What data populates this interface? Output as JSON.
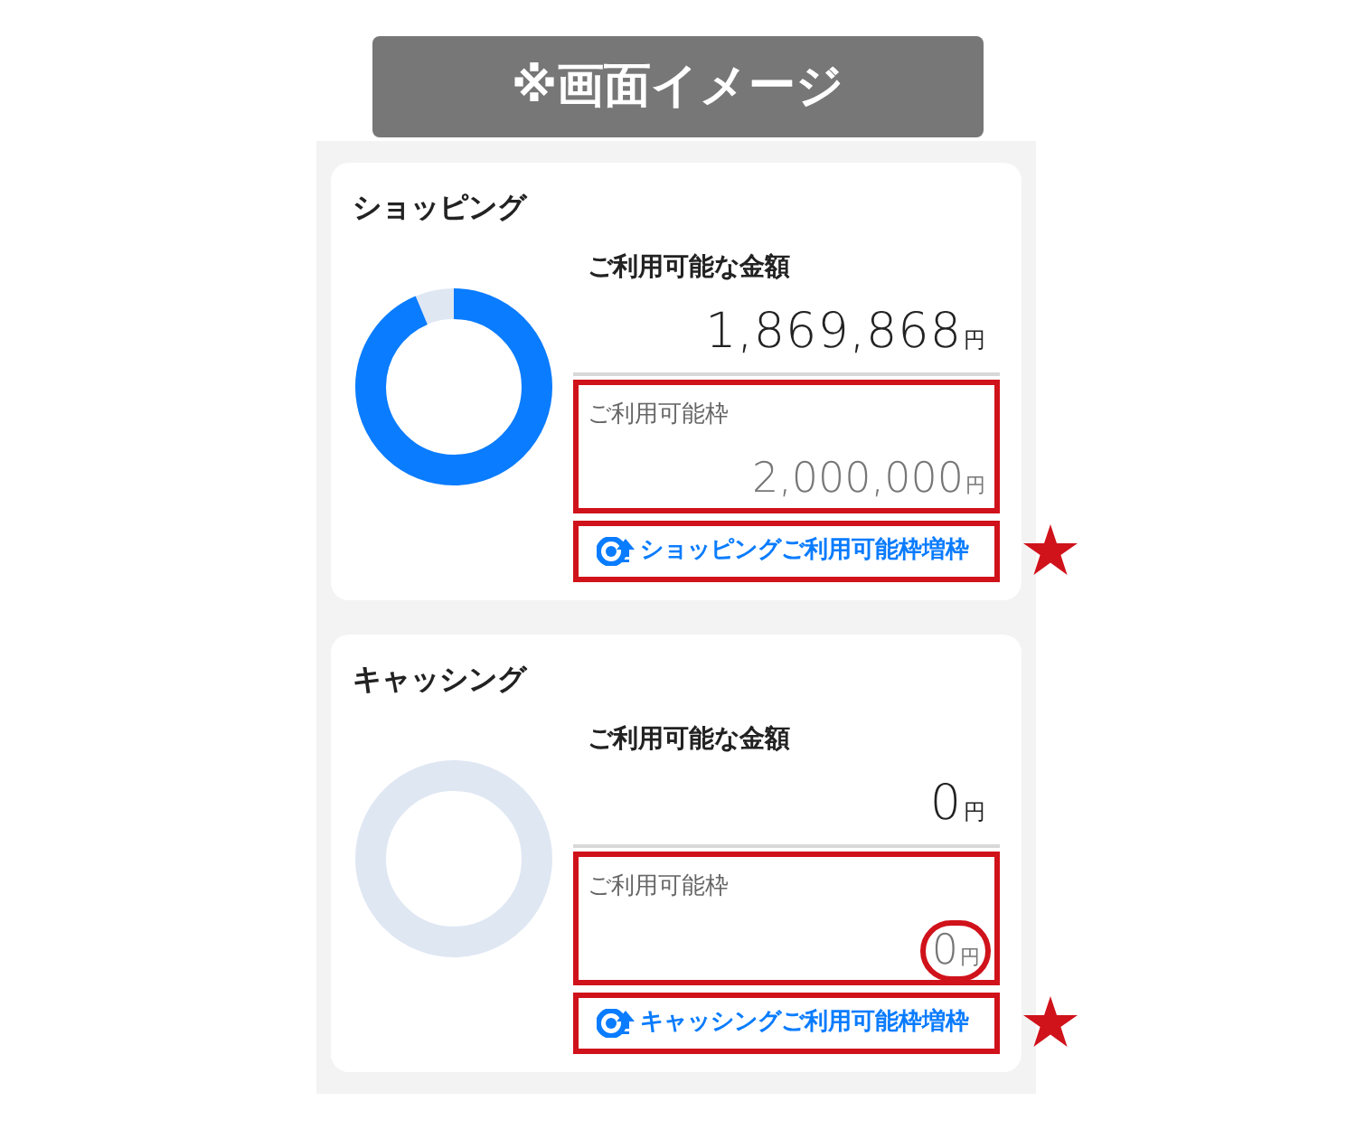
{
  "banner": {
    "title": "※画面イメージ"
  },
  "cards": [
    {
      "title": "ショッピング",
      "available_label": "ご利用可能な金額",
      "available_amount": "1,869,868",
      "available_unit": "円",
      "limit_label": "ご利用可能枠",
      "limit_amount": "2,000,000",
      "limit_unit": "円",
      "limit_highlighted": true,
      "limit_amount_circled": false,
      "link": "ショッピングご利用可能枠増枠",
      "link_highlighted": true,
      "starred": true
    },
    {
      "title": "キャッシング",
      "available_label": "ご利用可能な金額",
      "available_amount": "0",
      "available_unit": "円",
      "limit_label": "ご利用可能枠",
      "limit_amount": "0",
      "limit_unit": "円",
      "limit_highlighted": true,
      "limit_amount_circled": true,
      "link": "キャッシングご利用可能枠増枠",
      "link_highlighted": true,
      "starred": true
    }
  ]
}
